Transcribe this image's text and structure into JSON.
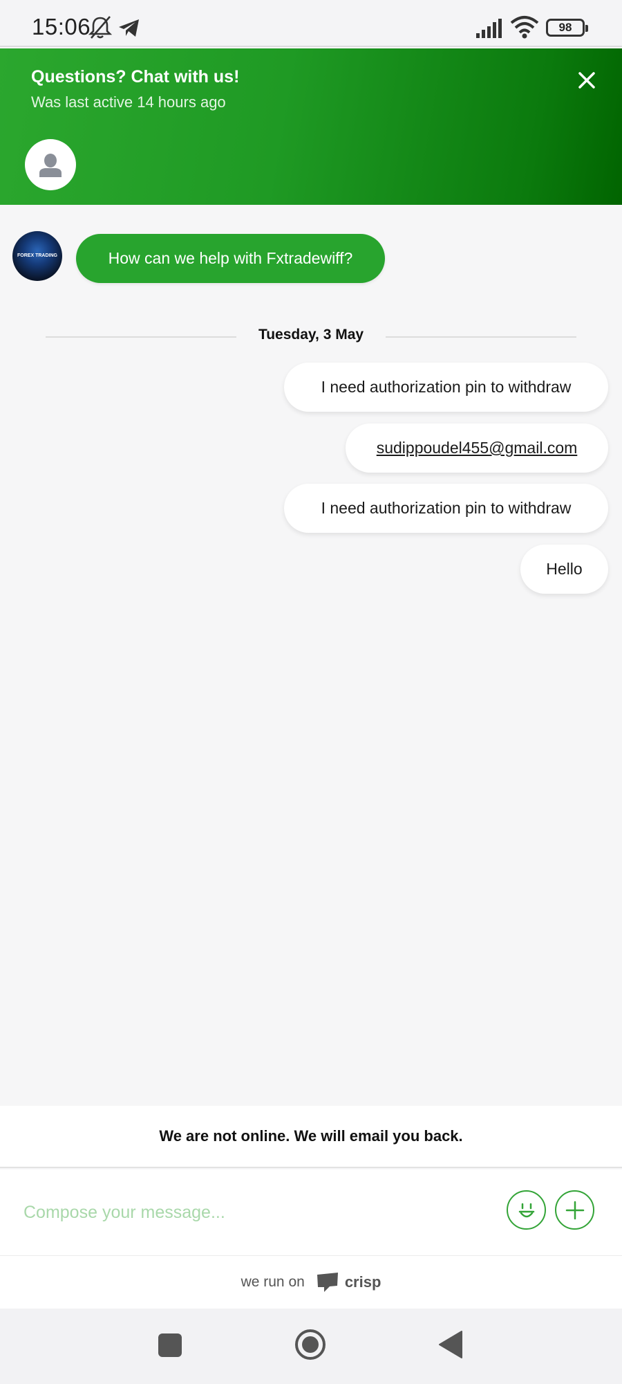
{
  "status_bar": {
    "time": "15:06",
    "battery": "98"
  },
  "header": {
    "title": "Questions? Chat with us!",
    "subtitle": "Was last active 14 hours ago"
  },
  "conversation": {
    "bot_avatar_text": "FOREX TRADING",
    "bot_message": "How can we help with Fxtradewiff?",
    "date_separator": "Tuesday, 3 May",
    "user_messages": [
      "I need authorization pin to withdraw",
      "sudippoudel455@gmail.com",
      "I need authorization pin to withdraw",
      "Hello"
    ]
  },
  "offline_notice": "We are not online. We will email you back.",
  "compose": {
    "placeholder": "Compose your message..."
  },
  "branding": {
    "prefix": "we run on",
    "name": "crisp"
  },
  "colors": {
    "accent_green": "#28a42e",
    "header_gradient_end": "#016400"
  }
}
